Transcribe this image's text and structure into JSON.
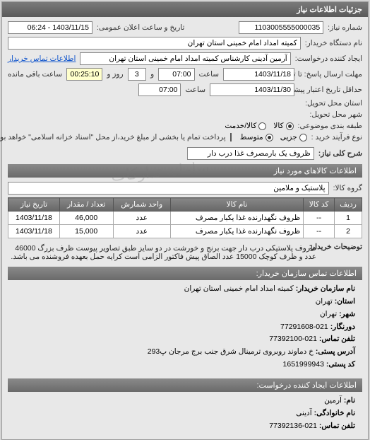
{
  "panel_title": "جزئیات اطلاعات نیاز",
  "labels": {
    "req_number": "شماره نیاز:",
    "public_notice": "تاریخ و ساعت اعلان عمومی:",
    "buyer_org": "نام دستگاه خریدار:",
    "requester": "ایجاد کننده درخواست:",
    "contact_link": "اطلاعات تماس خریدار",
    "deadline": "مهلت ارسال پاسخ: تا تاریخ:",
    "time_word": "ساعت",
    "days_and": "و",
    "day_word": "روز و",
    "remaining": "ساعت باقی مانده",
    "delivery_deadline": "حداقل تاریخ اعتبار پیشنهاد: تا تاریخ:",
    "delivery_province": "استان محل تحویل:",
    "delivery_city": "شهر محل تحویل:",
    "budget_class": "طبقه بندی موضوعی:",
    "goods": "کالا",
    "service": "کالا/خدمت",
    "buy_process": "نوع فرآیند خرید :",
    "partial": "جزیی",
    "medium": "متوسط",
    "pay_note": "پرداخت تمام یا بخشی از مبلغ خرید،از محل \"اسناد خزانه اسلامی\" خواهد بود.",
    "need_title": "شرح کلی نیاز:",
    "goods_group": "گروه کالا:",
    "desc_label": "توضیحات خریدار:"
  },
  "values": {
    "req_number": "1103005555000035",
    "public_notice": "1403/11/15 - 06:24",
    "buyer_org": "کمیته امداد امام خمینی استان تهران",
    "requester": "آرمین آدینی کارشناس کمیته امداد امام خمینی استان تهران",
    "deadline_date": "1403/11/18",
    "deadline_time": "07:00",
    "days_left": "3",
    "time_left": "00:25:10",
    "delivery_date": "1403/11/30",
    "delivery_time": "07:00",
    "need_title_value": "ظروف یک بارمصرف غذا درب دار",
    "goods_group_value": "پلاستیک و ملامین",
    "buyer_desc": "ظروف پلاستیکی درب دار جهت برنج و خورشت در دو سایز طبق تصاویر پیوست ظرف بزرگ 46000 عدد و ظرف کوچک 15000 عدد الصاق پیش فاکتور الزامی است کرایه حمل بعهده فروشنده می باشد."
  },
  "section_headers": {
    "goods_info": "اطلاعات کالاهای مورد نیاز",
    "buyer_contact": "اطلاعات تماس سازمان خریدار:",
    "creator_contact": "اطلاعات ایجاد کننده درخواست:"
  },
  "table": {
    "headers": [
      "ردیف",
      "کد کالا",
      "نام کالا",
      "واحد شمارش",
      "تعداد / مقدار",
      "تاریخ نیاز"
    ],
    "rows": [
      {
        "idx": "1",
        "code": "--",
        "name": "ظروف نگهدارنده غذا یکبار مصرف",
        "unit": "عدد",
        "qty": "46,000",
        "date": "1403/11/18"
      },
      {
        "idx": "2",
        "code": "--",
        "name": "ظروف نگهدارنده غذا یکبار مصرف",
        "unit": "عدد",
        "qty": "15,000",
        "date": "1403/11/18"
      }
    ]
  },
  "buyer_contact": {
    "name_lbl": "نام سازمان خریدار:",
    "name": "کمیته امداد امام خمینی استان تهران",
    "province_lbl": "استان:",
    "province": "تهران",
    "city_lbl": "شهر:",
    "city": "تهران",
    "fax_lbl": "دورنگار:",
    "fax": "021-77291608",
    "phone_lbl": "تلفن تماس:",
    "phone": "021-77392100",
    "postaddr_lbl": "آدرس پستی:",
    "postaddr": "خ دماوند روبروی ترمینال شرق جنب برج مرجان پ293",
    "postalcode_lbl": "کد پستی:",
    "postalcode": "1651999943"
  },
  "creator_contact": {
    "fname_lbl": "نام:",
    "fname": "آرمین",
    "lname_lbl": "نام خانوادگی:",
    "lname": "آدینی",
    "phone_lbl": "تلفن تماس:",
    "phone": "021-77392136"
  },
  "watermark": "سامانه تدارکات"
}
